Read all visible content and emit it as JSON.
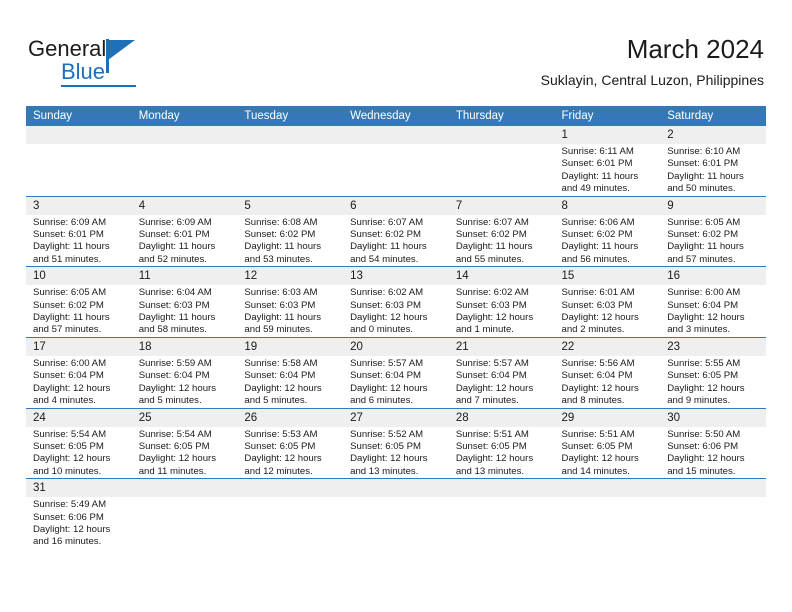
{
  "brand": {
    "name_top": "General",
    "name_bottom": "Blue",
    "accent_color": "#1d6fb8"
  },
  "header": {
    "month_title": "March 2024",
    "location": "Suklayin, Central Luzon, Philippines",
    "header_bg_color": "#3479b5",
    "daynum_bg_color": "#efefef"
  },
  "weekdays": [
    "Sunday",
    "Monday",
    "Tuesday",
    "Wednesday",
    "Thursday",
    "Friday",
    "Saturday"
  ],
  "weeks": [
    [
      {
        "day": "",
        "sunrise": "",
        "sunset": "",
        "daylight1": "",
        "daylight2": "",
        "empty": true
      },
      {
        "day": "",
        "sunrise": "",
        "sunset": "",
        "daylight1": "",
        "daylight2": "",
        "empty": true
      },
      {
        "day": "",
        "sunrise": "",
        "sunset": "",
        "daylight1": "",
        "daylight2": "",
        "empty": true
      },
      {
        "day": "",
        "sunrise": "",
        "sunset": "",
        "daylight1": "",
        "daylight2": "",
        "empty": true
      },
      {
        "day": "",
        "sunrise": "",
        "sunset": "",
        "daylight1": "",
        "daylight2": "",
        "empty": true
      },
      {
        "day": "1",
        "sunrise": "Sunrise: 6:11 AM",
        "sunset": "Sunset: 6:01 PM",
        "daylight1": "Daylight: 11 hours",
        "daylight2": "and 49 minutes.",
        "empty": false
      },
      {
        "day": "2",
        "sunrise": "Sunrise: 6:10 AM",
        "sunset": "Sunset: 6:01 PM",
        "daylight1": "Daylight: 11 hours",
        "daylight2": "and 50 minutes.",
        "empty": false
      }
    ],
    [
      {
        "day": "3",
        "sunrise": "Sunrise: 6:09 AM",
        "sunset": "Sunset: 6:01 PM",
        "daylight1": "Daylight: 11 hours",
        "daylight2": "and 51 minutes.",
        "empty": false
      },
      {
        "day": "4",
        "sunrise": "Sunrise: 6:09 AM",
        "sunset": "Sunset: 6:01 PM",
        "daylight1": "Daylight: 11 hours",
        "daylight2": "and 52 minutes.",
        "empty": false
      },
      {
        "day": "5",
        "sunrise": "Sunrise: 6:08 AM",
        "sunset": "Sunset: 6:02 PM",
        "daylight1": "Daylight: 11 hours",
        "daylight2": "and 53 minutes.",
        "empty": false
      },
      {
        "day": "6",
        "sunrise": "Sunrise: 6:07 AM",
        "sunset": "Sunset: 6:02 PM",
        "daylight1": "Daylight: 11 hours",
        "daylight2": "and 54 minutes.",
        "empty": false
      },
      {
        "day": "7",
        "sunrise": "Sunrise: 6:07 AM",
        "sunset": "Sunset: 6:02 PM",
        "daylight1": "Daylight: 11 hours",
        "daylight2": "and 55 minutes.",
        "empty": false
      },
      {
        "day": "8",
        "sunrise": "Sunrise: 6:06 AM",
        "sunset": "Sunset: 6:02 PM",
        "daylight1": "Daylight: 11 hours",
        "daylight2": "and 56 minutes.",
        "empty": false
      },
      {
        "day": "9",
        "sunrise": "Sunrise: 6:05 AM",
        "sunset": "Sunset: 6:02 PM",
        "daylight1": "Daylight: 11 hours",
        "daylight2": "and 57 minutes.",
        "empty": false
      }
    ],
    [
      {
        "day": "10",
        "sunrise": "Sunrise: 6:05 AM",
        "sunset": "Sunset: 6:02 PM",
        "daylight1": "Daylight: 11 hours",
        "daylight2": "and 57 minutes.",
        "empty": false
      },
      {
        "day": "11",
        "sunrise": "Sunrise: 6:04 AM",
        "sunset": "Sunset: 6:03 PM",
        "daylight1": "Daylight: 11 hours",
        "daylight2": "and 58 minutes.",
        "empty": false
      },
      {
        "day": "12",
        "sunrise": "Sunrise: 6:03 AM",
        "sunset": "Sunset: 6:03 PM",
        "daylight1": "Daylight: 11 hours",
        "daylight2": "and 59 minutes.",
        "empty": false
      },
      {
        "day": "13",
        "sunrise": "Sunrise: 6:02 AM",
        "sunset": "Sunset: 6:03 PM",
        "daylight1": "Daylight: 12 hours",
        "daylight2": "and 0 minutes.",
        "empty": false
      },
      {
        "day": "14",
        "sunrise": "Sunrise: 6:02 AM",
        "sunset": "Sunset: 6:03 PM",
        "daylight1": "Daylight: 12 hours",
        "daylight2": "and 1 minute.",
        "empty": false
      },
      {
        "day": "15",
        "sunrise": "Sunrise: 6:01 AM",
        "sunset": "Sunset: 6:03 PM",
        "daylight1": "Daylight: 12 hours",
        "daylight2": "and 2 minutes.",
        "empty": false
      },
      {
        "day": "16",
        "sunrise": "Sunrise: 6:00 AM",
        "sunset": "Sunset: 6:04 PM",
        "daylight1": "Daylight: 12 hours",
        "daylight2": "and 3 minutes.",
        "empty": false
      }
    ],
    [
      {
        "day": "17",
        "sunrise": "Sunrise: 6:00 AM",
        "sunset": "Sunset: 6:04 PM",
        "daylight1": "Daylight: 12 hours",
        "daylight2": "and 4 minutes.",
        "empty": false
      },
      {
        "day": "18",
        "sunrise": "Sunrise: 5:59 AM",
        "sunset": "Sunset: 6:04 PM",
        "daylight1": "Daylight: 12 hours",
        "daylight2": "and 5 minutes.",
        "empty": false
      },
      {
        "day": "19",
        "sunrise": "Sunrise: 5:58 AM",
        "sunset": "Sunset: 6:04 PM",
        "daylight1": "Daylight: 12 hours",
        "daylight2": "and 5 minutes.",
        "empty": false
      },
      {
        "day": "20",
        "sunrise": "Sunrise: 5:57 AM",
        "sunset": "Sunset: 6:04 PM",
        "daylight1": "Daylight: 12 hours",
        "daylight2": "and 6 minutes.",
        "empty": false
      },
      {
        "day": "21",
        "sunrise": "Sunrise: 5:57 AM",
        "sunset": "Sunset: 6:04 PM",
        "daylight1": "Daylight: 12 hours",
        "daylight2": "and 7 minutes.",
        "empty": false
      },
      {
        "day": "22",
        "sunrise": "Sunrise: 5:56 AM",
        "sunset": "Sunset: 6:04 PM",
        "daylight1": "Daylight: 12 hours",
        "daylight2": "and 8 minutes.",
        "empty": false
      },
      {
        "day": "23",
        "sunrise": "Sunrise: 5:55 AM",
        "sunset": "Sunset: 6:05 PM",
        "daylight1": "Daylight: 12 hours",
        "daylight2": "and 9 minutes.",
        "empty": false
      }
    ],
    [
      {
        "day": "24",
        "sunrise": "Sunrise: 5:54 AM",
        "sunset": "Sunset: 6:05 PM",
        "daylight1": "Daylight: 12 hours",
        "daylight2": "and 10 minutes.",
        "empty": false
      },
      {
        "day": "25",
        "sunrise": "Sunrise: 5:54 AM",
        "sunset": "Sunset: 6:05 PM",
        "daylight1": "Daylight: 12 hours",
        "daylight2": "and 11 minutes.",
        "empty": false
      },
      {
        "day": "26",
        "sunrise": "Sunrise: 5:53 AM",
        "sunset": "Sunset: 6:05 PM",
        "daylight1": "Daylight: 12 hours",
        "daylight2": "and 12 minutes.",
        "empty": false
      },
      {
        "day": "27",
        "sunrise": "Sunrise: 5:52 AM",
        "sunset": "Sunset: 6:05 PM",
        "daylight1": "Daylight: 12 hours",
        "daylight2": "and 13 minutes.",
        "empty": false
      },
      {
        "day": "28",
        "sunrise": "Sunrise: 5:51 AM",
        "sunset": "Sunset: 6:05 PM",
        "daylight1": "Daylight: 12 hours",
        "daylight2": "and 13 minutes.",
        "empty": false
      },
      {
        "day": "29",
        "sunrise": "Sunrise: 5:51 AM",
        "sunset": "Sunset: 6:05 PM",
        "daylight1": "Daylight: 12 hours",
        "daylight2": "and 14 minutes.",
        "empty": false
      },
      {
        "day": "30",
        "sunrise": "Sunrise: 5:50 AM",
        "sunset": "Sunset: 6:06 PM",
        "daylight1": "Daylight: 12 hours",
        "daylight2": "and 15 minutes.",
        "empty": false
      }
    ],
    [
      {
        "day": "31",
        "sunrise": "Sunrise: 5:49 AM",
        "sunset": "Sunset: 6:06 PM",
        "daylight1": "Daylight: 12 hours",
        "daylight2": "and 16 minutes.",
        "empty": false
      },
      {
        "day": "",
        "sunrise": "",
        "sunset": "",
        "daylight1": "",
        "daylight2": "",
        "empty": true
      },
      {
        "day": "",
        "sunrise": "",
        "sunset": "",
        "daylight1": "",
        "daylight2": "",
        "empty": true
      },
      {
        "day": "",
        "sunrise": "",
        "sunset": "",
        "daylight1": "",
        "daylight2": "",
        "empty": true
      },
      {
        "day": "",
        "sunrise": "",
        "sunset": "",
        "daylight1": "",
        "daylight2": "",
        "empty": true
      },
      {
        "day": "",
        "sunrise": "",
        "sunset": "",
        "daylight1": "",
        "daylight2": "",
        "empty": true
      },
      {
        "day": "",
        "sunrise": "",
        "sunset": "",
        "daylight1": "",
        "daylight2": "",
        "empty": true
      }
    ]
  ]
}
